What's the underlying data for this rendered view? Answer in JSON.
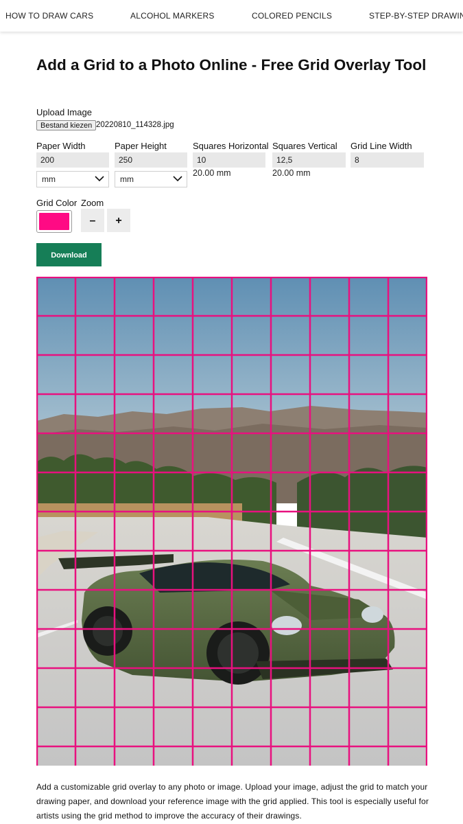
{
  "nav": {
    "items": [
      "HOW TO DRAW CARS",
      "ALCOHOL MARKERS",
      "COLORED PENCILS",
      "STEP-BY-STEP DRAWING"
    ]
  },
  "page": {
    "title": "Add a Grid to a Photo Online - Free Grid Overlay Tool",
    "description": "Add a customizable grid overlay to any photo or image. Upload your image, adjust the grid to match your drawing paper, and download your reference image with the grid applied. This tool is especially useful for artists using the grid method to improve the accuracy of their drawings."
  },
  "upload": {
    "label": "Upload Image",
    "button_label": "Bestand kiezen",
    "filename": "20220810_114328.jpg"
  },
  "fields": {
    "paper_width": {
      "label": "Paper Width",
      "value": "200",
      "unit": "mm"
    },
    "paper_height": {
      "label": "Paper Height",
      "value": "250",
      "unit": "mm"
    },
    "squares_horizontal": {
      "label": "Squares Horizontal",
      "value": "10",
      "computed": "20.00 mm"
    },
    "squares_vertical": {
      "label": "Squares Vertical",
      "value": "12,5",
      "computed": "20.00 mm"
    },
    "grid_line_width": {
      "label": "Grid Line Width",
      "value": "8"
    }
  },
  "grid_color": {
    "label": "Grid Color",
    "value": "#ff0a84"
  },
  "zoom": {
    "label": "Zoom",
    "minus": "–",
    "plus": "+"
  },
  "download_label": "Download Image",
  "icons": {
    "select_arrow": "chevron-down-icon"
  },
  "preview": {
    "grid_columns": 10,
    "grid_rows": 12.5,
    "grid_color": "#e8117f",
    "sky_color": "#6f98b8",
    "car_color": "#55683e",
    "road_color": "#cfcfcd"
  }
}
